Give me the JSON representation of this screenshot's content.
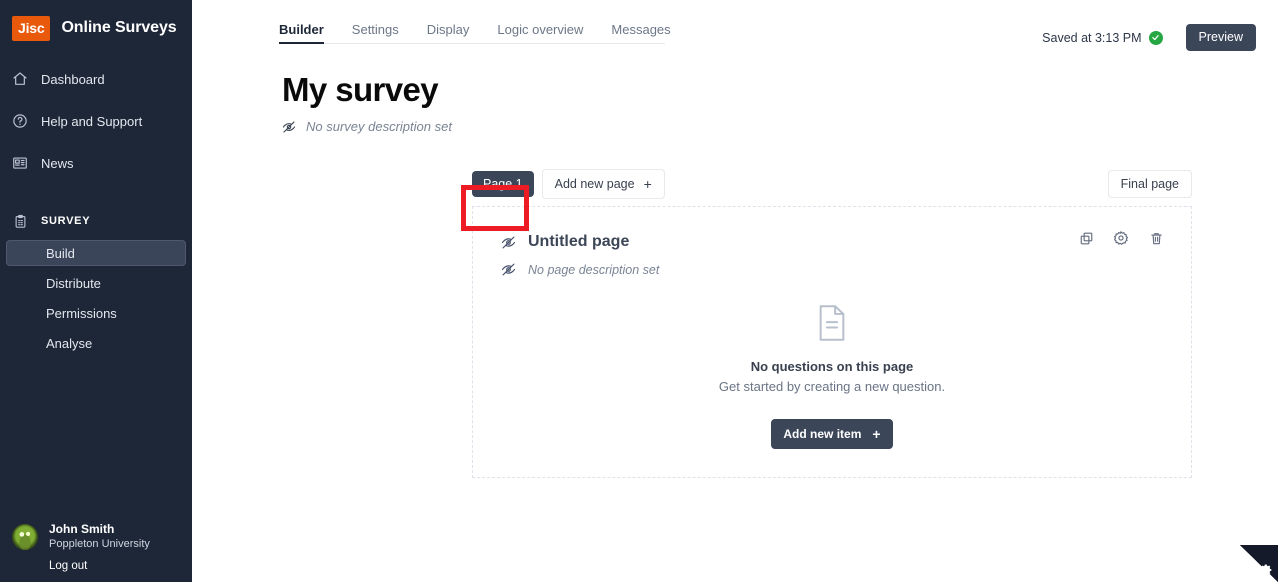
{
  "brand": {
    "logo_text": "Jisc",
    "title": "Online Surveys",
    "logo_color": "#e8590c"
  },
  "sidebar": {
    "nav": [
      {
        "label": "Dashboard",
        "icon": "home-icon"
      },
      {
        "label": "Help and Support",
        "icon": "question-circle-icon"
      },
      {
        "label": "News",
        "icon": "newspaper-icon"
      }
    ],
    "section": {
      "label": "SURVEY",
      "icon": "clipboard-icon"
    },
    "sub_items": [
      {
        "label": "Build",
        "active": true
      },
      {
        "label": "Distribute",
        "active": false
      },
      {
        "label": "Permissions",
        "active": false
      },
      {
        "label": "Analyse",
        "active": false
      }
    ],
    "user": {
      "name": "John Smith",
      "org": "Poppleton University",
      "logout_label": "Log out",
      "avatar_icon": "duck-avatar"
    },
    "background_color": "#1e2738"
  },
  "topbar": {
    "tabs": [
      {
        "label": "Builder",
        "active": true
      },
      {
        "label": "Settings",
        "active": false
      },
      {
        "label": "Display",
        "active": false
      },
      {
        "label": "Logic overview",
        "active": false
      },
      {
        "label": "Messages",
        "active": false
      }
    ],
    "saved_status": "Saved at 3:13 PM",
    "saved_icon": "check-circle-icon",
    "saved_color": "#27a744",
    "preview_label": "Preview"
  },
  "survey": {
    "title": "My survey",
    "description_placeholder": "No survey description set",
    "description_icon": "eye-off-icon"
  },
  "pagestrip": {
    "page_tab_label": "Page 1",
    "add_page_label": "Add new page",
    "add_page_plus": "+",
    "final_page_label": "Final page"
  },
  "page_card": {
    "title": "Untitled page",
    "title_icon": "eye-off-icon",
    "description_placeholder": "No page description set",
    "description_icon": "eye-off-icon",
    "actions": [
      {
        "name": "duplicate-page-icon"
      },
      {
        "name": "page-settings-icon"
      },
      {
        "name": "delete-page-icon"
      }
    ],
    "empty_state": {
      "icon": "document-icon",
      "title": "No questions on this page",
      "subtitle": "Get started by creating a new question."
    },
    "add_item_label": "Add new item",
    "add_item_plus": "+"
  },
  "annotations": {
    "color": "#ed1c24",
    "boxes": [
      {
        "name": "page-1-highlight"
      },
      {
        "name": "final-page-highlight"
      }
    ]
  },
  "corner_widget": {
    "icon": "cookie-settings-gear-icon"
  }
}
